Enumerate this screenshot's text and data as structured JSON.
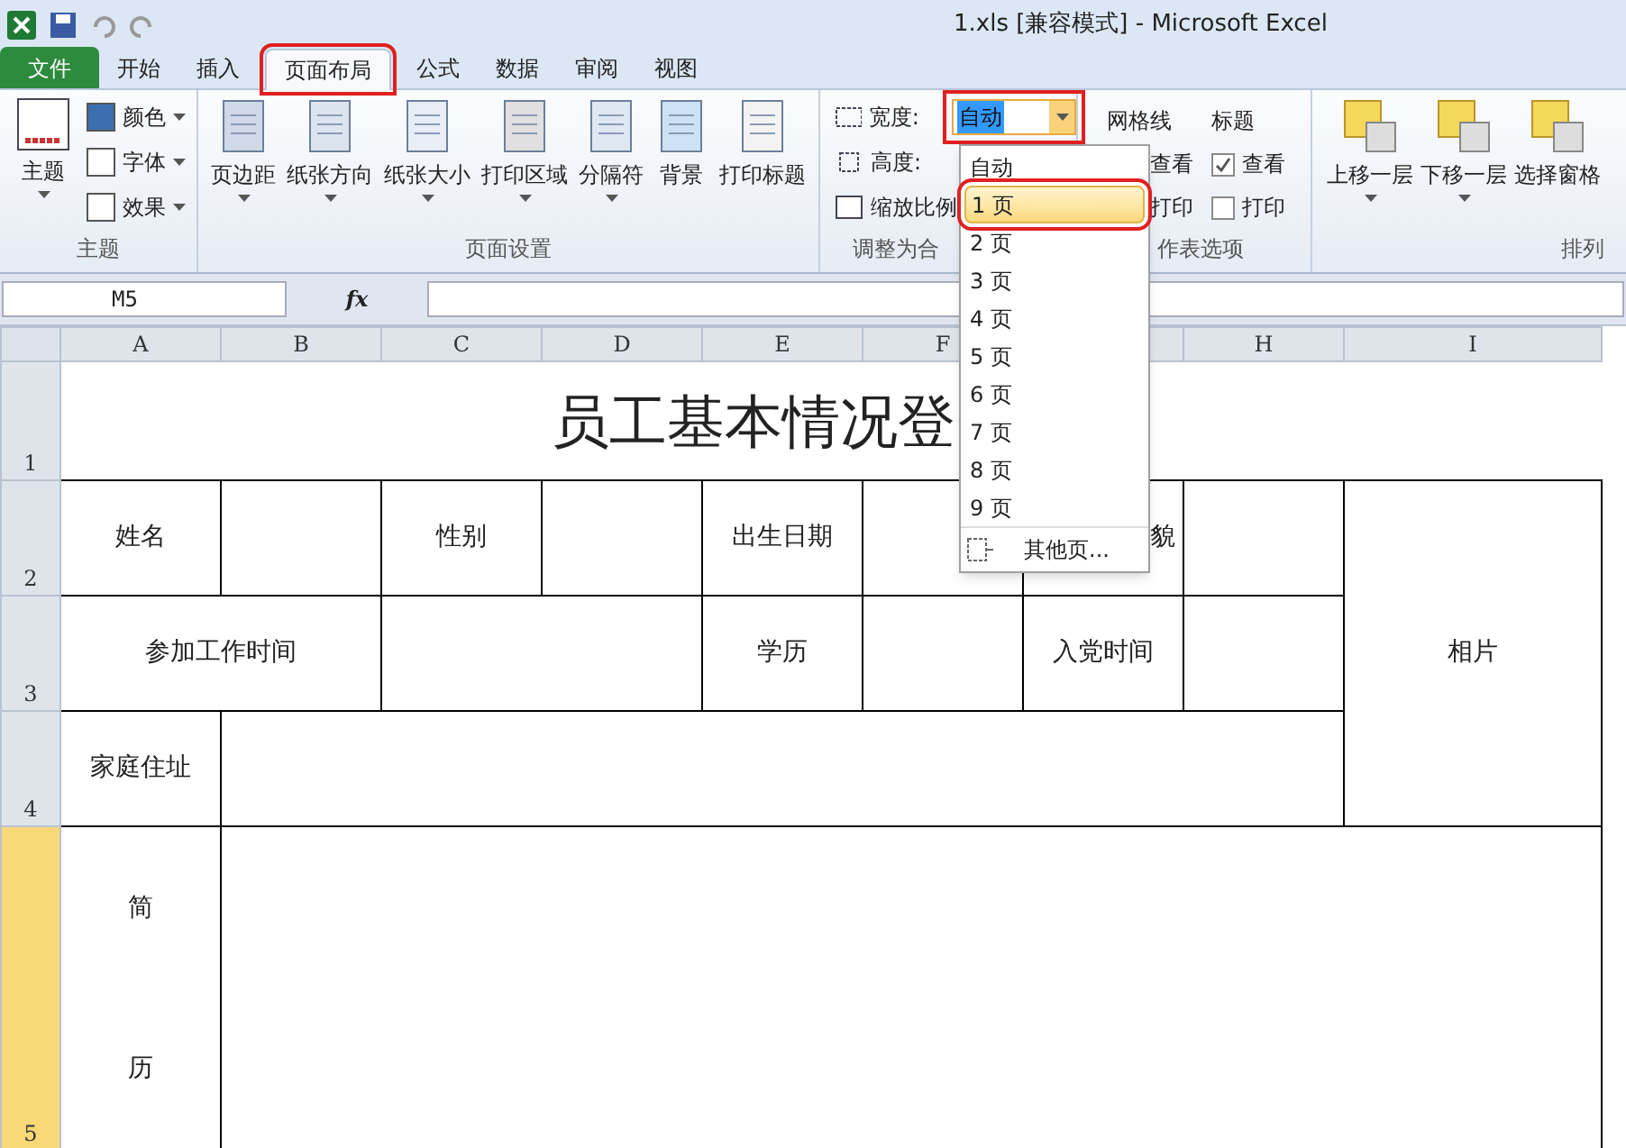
{
  "window": {
    "title": "1.xls  [兼容模式]  -  Microsoft Excel"
  },
  "tabs": [
    {
      "label": "文件",
      "kind": "file",
      "selected": false
    },
    {
      "label": "开始",
      "kind": "tab",
      "selected": false
    },
    {
      "label": "插入",
      "kind": "tab",
      "selected": false
    },
    {
      "label": "页面布局",
      "kind": "tab",
      "selected": true
    },
    {
      "label": "公式",
      "kind": "tab",
      "selected": false
    },
    {
      "label": "数据",
      "kind": "tab",
      "selected": false
    },
    {
      "label": "审阅",
      "kind": "tab",
      "selected": false
    },
    {
      "label": "视图",
      "kind": "tab",
      "selected": false
    }
  ],
  "ribbon": {
    "themes": {
      "label": "主题",
      "button": "主题",
      "items": [
        "颜色",
        "字体",
        "效果"
      ]
    },
    "page_setup": {
      "label": "页面设置",
      "buttons": [
        {
          "label": "页边距",
          "menu": true
        },
        {
          "label": "纸张方向",
          "menu": true
        },
        {
          "label": "纸张大小",
          "menu": true
        },
        {
          "label": "打印区域",
          "menu": true
        },
        {
          "label": "分隔符",
          "menu": true
        },
        {
          "label": "背景",
          "menu": false
        },
        {
          "label": "打印标题",
          "menu": false
        }
      ]
    },
    "scale": {
      "label": "调整为合",
      "width_label": "宽度:",
      "width_value": "自动",
      "height_label": "高度:",
      "zoom_label": "缩放比例"
    },
    "sheet_options": {
      "label": "作表选项",
      "gridlines": {
        "title": "网格线",
        "view": "查看",
        "print": "打印"
      },
      "headings": {
        "title": "标题",
        "view": {
          "label": "查看",
          "checked": true
        },
        "print": {
          "label": "打印",
          "checked": false
        }
      }
    },
    "arrange": {
      "label": "排列",
      "buttons": [
        {
          "label": "上移一层",
          "menu": true
        },
        {
          "label": "下移一层",
          "menu": true
        },
        {
          "label": "选择窗格",
          "menu": false
        }
      ]
    }
  },
  "name_box": "M5",
  "formula_label": "fx",
  "columns": [
    "A",
    "B",
    "C",
    "D",
    "E",
    "F",
    "H",
    "I"
  ],
  "rows": [
    {
      "header": "1",
      "selected": false,
      "cells": [
        {
          "text": "员工基本情况登",
          "kind": "title"
        }
      ]
    },
    {
      "header": "2",
      "selected": false,
      "cells": [
        {
          "text": "姓名"
        },
        {},
        {
          "text": "性别"
        },
        {},
        {
          "text": "出生日期"
        },
        {},
        {
          "text": "貌",
          "kind": "right"
        },
        {},
        {
          "text": "相片"
        }
      ]
    },
    {
      "header": "3",
      "selected": false,
      "cells": [
        {
          "text": "参加工作时间"
        },
        {},
        {
          "text": "学历"
        },
        {},
        {
          "text": "入党时间"
        },
        {}
      ]
    },
    {
      "header": "4",
      "selected": false,
      "cells": [
        {
          "text": "家庭住址"
        },
        {}
      ]
    },
    {
      "header": "5",
      "selected": true,
      "cells": [
        {
          "lines": [
            "简",
            "历"
          ]
        },
        {}
      ]
    }
  ],
  "dropdown": {
    "items": [
      {
        "label": "自动",
        "selected": false
      },
      {
        "label": "1 页",
        "selected": true
      },
      {
        "label": "2 页",
        "selected": false
      },
      {
        "label": "3 页",
        "selected": false
      },
      {
        "label": "4 页",
        "selected": false
      },
      {
        "label": "5 页",
        "selected": false
      },
      {
        "label": "6 页",
        "selected": false
      },
      {
        "label": "7 页",
        "selected": false
      },
      {
        "label": "8 页",
        "selected": false
      },
      {
        "label": "9 页",
        "selected": false
      }
    ],
    "more": "其他页..."
  }
}
